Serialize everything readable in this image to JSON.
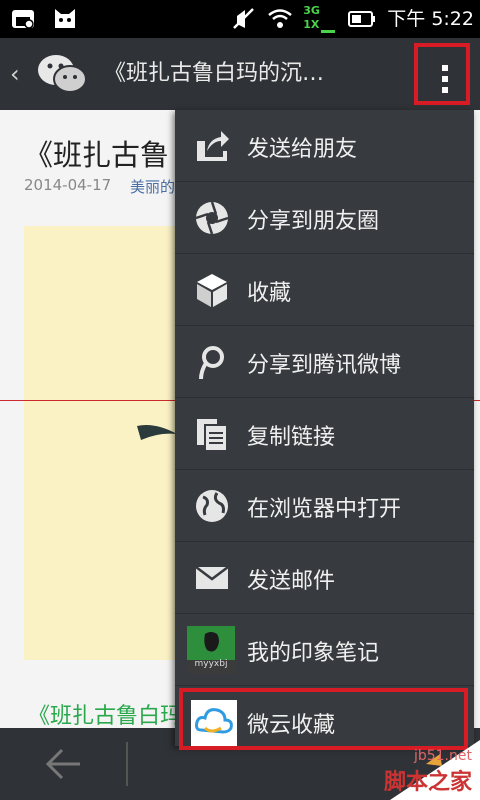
{
  "status_bar": {
    "network_label_top": "3G",
    "network_label_bottom": "1X",
    "time": "下午 5:22"
  },
  "action_bar": {
    "back_icon": "chevron-left-icon",
    "logo_icon": "wechat-logo-icon",
    "title": "《班扎古鲁白玛的沉…",
    "overflow_icon": "overflow-menu-icon"
  },
  "article": {
    "title": "《班扎古鲁",
    "date": "2014-04-17",
    "source": "美丽的",
    "link_text": "《班扎古鲁白玛"
  },
  "menu": {
    "items": [
      {
        "label": "发送给朋友",
        "icon": "share-arrow-icon"
      },
      {
        "label": "分享到朋友圈",
        "icon": "moments-aperture-icon"
      },
      {
        "label": "收藏",
        "icon": "cube-favorite-icon"
      },
      {
        "label": "分享到腾讯微博",
        "icon": "tencent-weibo-icon"
      },
      {
        "label": "复制链接",
        "icon": "copy-link-icon"
      },
      {
        "label": "在浏览器中打开",
        "icon": "globe-icon"
      },
      {
        "label": "发送邮件",
        "icon": "mail-icon"
      },
      {
        "label": "我的印象笔记",
        "icon": "evernote-icon",
        "icon_caption": "myyxbj"
      },
      {
        "label": "微云收藏",
        "icon": "weiyun-cloud-icon"
      }
    ]
  },
  "watermark": {
    "site": "jb51.net",
    "name": "脚本之家"
  },
  "colors": {
    "bar_bg": "#2f3236",
    "menu_bg": "#373a3e",
    "highlight": "#d81c25",
    "link_green": "#2aa84b"
  }
}
